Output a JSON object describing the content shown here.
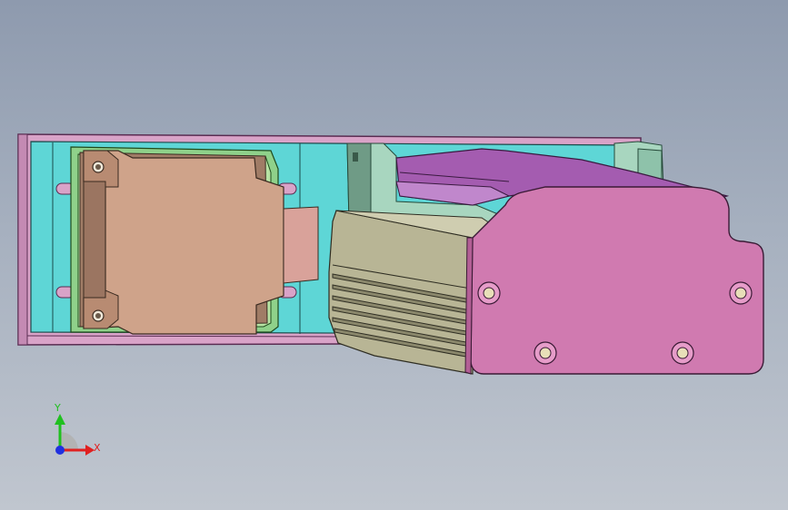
{
  "window": {
    "title": ""
  },
  "model": {
    "colors": {
      "base_plate": "#d9a3c8",
      "base_plate_edge": "#6b3a60",
      "cyan_plate": "#5ed6d6",
      "green_frame": "#8fd18a",
      "tan_block": "#cfa38a",
      "tan_block_shadow": "#a07c66",
      "olive_body": "#b8b595",
      "olive_shadow": "#8b886c",
      "magenta_end": "#d07ab0",
      "purple_rail": "#a45cb0",
      "mint_bracket": "#a8d6bf"
    }
  },
  "triad": {
    "x_label": "X",
    "y_label": "Y",
    "x_color": "#e02020",
    "y_color": "#20c020",
    "z_color": "#2030e0"
  }
}
